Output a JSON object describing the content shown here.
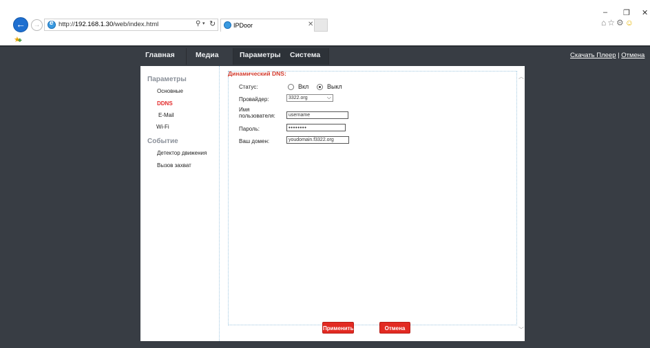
{
  "browser": {
    "url_prefix": "http://",
    "url_host": "192.168.1.30",
    "url_path": "/web/index.html",
    "tab_title": "IPDoor",
    "icons": [
      "back-icon",
      "forward-icon",
      "search-icon",
      "refresh-icon",
      "home-icon",
      "star-icon",
      "gear-icon",
      "smiley-icon",
      "favorites-icon"
    ]
  },
  "topnav": {
    "items": [
      "Главная",
      "Медиа",
      "Параметры",
      "Система"
    ],
    "download_player": "Скачать Плеер",
    "separator": "|",
    "cancel_link": "Отмена"
  },
  "sidebar": {
    "group1_title": "Параметры",
    "group1_items": [
      "Основные",
      "DDNS",
      "E-Mail",
      "Wi-Fi"
    ],
    "active_item": "DDNS",
    "group2_title": "Событие",
    "group2_items": [
      "Детектор движения",
      "Вызов захват"
    ]
  },
  "form": {
    "title": "Динамический DNS:",
    "status_label": "Статус:",
    "status_on": "Вкл",
    "status_off": "Выкл",
    "status_value": "Выкл",
    "provider_label": "Провайдер:",
    "provider_value": "3322.org",
    "username_label_1": "Имя",
    "username_label_2": "пользователя:",
    "username_value": "username",
    "password_label": "Пароль:",
    "password_value": "••••••••",
    "domain_label": "Ваш домен:",
    "domain_value": "youdomain.f3322.org"
  },
  "buttons": {
    "apply": "Применить",
    "cancel": "Отмена"
  },
  "colors": {
    "accent_red": "#e22a22",
    "page_bg": "#383d44",
    "panel_bg": "#ffffff"
  }
}
